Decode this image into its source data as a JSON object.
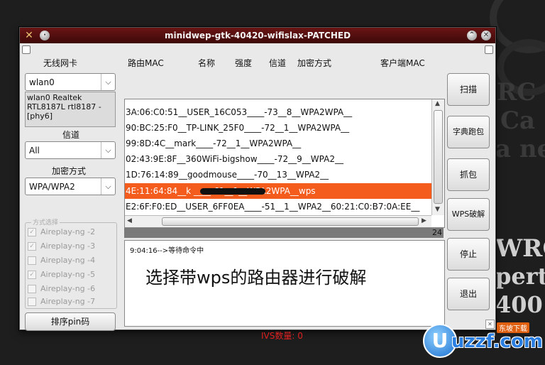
{
  "window": {
    "title": "minidwep-gtk-40420-wifislax-PATCHED"
  },
  "headers": {
    "wireless_card": "无线网卡",
    "router_mac": "路由MAC",
    "name": "名称",
    "strength": "强度",
    "channel": "信道",
    "encryption": "加密方式",
    "client_mac": "客户端MAC"
  },
  "interface": {
    "selected": "wlan0",
    "info": "wlan0 Realtek RTL8187L rtl8187 - [phy6]"
  },
  "channel": {
    "label": "信道",
    "selected": "All"
  },
  "encryption": {
    "label": "加密方式",
    "selected": "WPA/WPA2"
  },
  "methods": {
    "title": "方式选择",
    "items": [
      {
        "label": "Aireplay-ng -2",
        "checked": true
      },
      {
        "label": "Aireplay-ng -3",
        "checked": true
      },
      {
        "label": "Aireplay-ng -4",
        "checked": false
      },
      {
        "label": "Aireplay-ng -5",
        "checked": true
      },
      {
        "label": "Aireplay-ng -6",
        "checked": false
      },
      {
        "label": "Aireplay-ng -7",
        "checked": false
      }
    ]
  },
  "sort_pin_button": "排序pin码",
  "rows": [
    {
      "text": "3A:06:C0:51__USER_16C053____-73__8__WPA2WPA__"
    },
    {
      "text": "90:BC:25:F0__TP-LINK_25F0____-72__1__WPA2WPA__"
    },
    {
      "text": "99:8D:4C__mark____-72__1__WPA2WPA__"
    },
    {
      "text": "02:43:9E:8F__360WiFi-bigshow____-72__9__WPA2__"
    },
    {
      "text": "1D:76:14:89__goodmouse____-70__13__WPA2__"
    },
    {
      "text": "4E:11:64:84__k                    ____-61__1__WPA2WPA__wps"
    },
    {
      "text": "E2:6F:F0:ED__USER_6FF0EA____-51__1__WPA2__60:21:C0:B7:0A:EE__"
    }
  ],
  "progress_value": "24",
  "log_line": "9:04:16-->等待命令中",
  "annotation": "选择带wps的路由器进行破解",
  "ivs": "IVS数量: 0",
  "buttons": {
    "scan": "扫描",
    "dict": "字典跑包",
    "capture": "抓包",
    "wps": "WPS破解",
    "stop": "停止",
    "exit": "退出"
  },
  "desktop": {
    "text_rc": "RC",
    "text_ca": "Ca",
    "text_ne": "a ne",
    "text_wrc": "WRC",
    "text_pert": "pertl",
    "text_400": "400"
  },
  "watermark": {
    "brand": "uzzf.com",
    "tag": "东坡下载"
  },
  "colors": {
    "selection": "#f45c1e",
    "titlebar": "#5a1010",
    "ivs": "#e02020"
  }
}
